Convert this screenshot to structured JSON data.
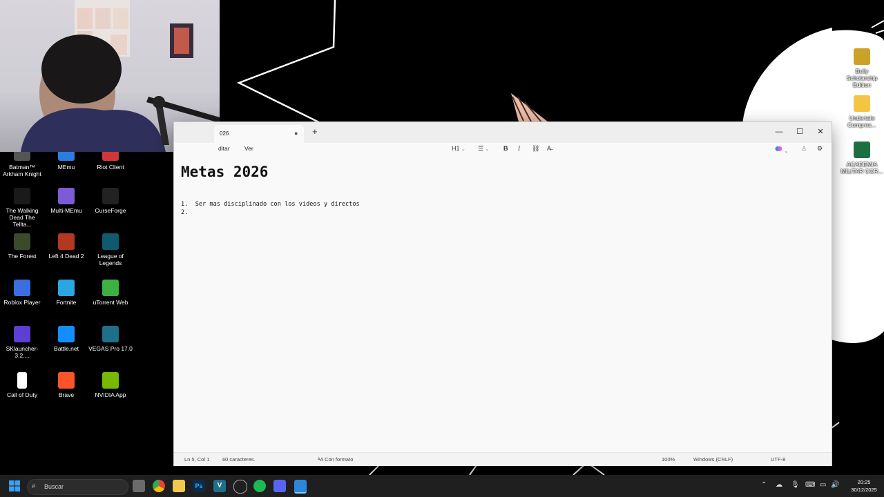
{
  "desktop": {
    "icons_left": [
      {
        "label": "Batman™ Arkham Knight",
        "icon": "batman-icon",
        "color": "#555555"
      },
      {
        "label": "MEmu",
        "icon": "memu-icon",
        "color": "#2a7de1"
      },
      {
        "label": "Riot Client",
        "icon": "riot-icon",
        "color": "#d13639"
      },
      {
        "label": "The Walking Dead The Tellta...",
        "icon": "walking-dead-icon",
        "color": "#1a1a1a"
      },
      {
        "label": "Multi-MEmu",
        "icon": "multi-memu-icon",
        "color": "#7b5cd6"
      },
      {
        "label": "CurseForge",
        "icon": "curseforge-icon",
        "color": "#222222"
      },
      {
        "label": "The Forest",
        "icon": "the-forest-icon",
        "color": "#3b4a2a"
      },
      {
        "label": "Left 4 Dead 2",
        "icon": "left4dead-icon",
        "color": "#b4381f"
      },
      {
        "label": "League of Legends",
        "icon": "league-icon",
        "color": "#0f5a6e"
      },
      {
        "label": "Roblox Player",
        "icon": "roblox-icon",
        "color": "#3b6fe0"
      },
      {
        "label": "Fortnite",
        "icon": "fortnite-icon",
        "color": "#2aa6e0"
      },
      {
        "label": "uTorrent Web",
        "icon": "utorrent-icon",
        "color": "#3cb043"
      },
      {
        "label": "SKlauncher-3.2....",
        "icon": "sklauncher-icon",
        "color": "#5d3fd3"
      },
      {
        "label": "Battle.net",
        "icon": "battlenet-icon",
        "color": "#148eff"
      },
      {
        "label": "VEGAS Pro 17.0",
        "icon": "vegas-icon",
        "color": "#1f6f8b"
      },
      {
        "label": "Call of Duty",
        "icon": "file-icon",
        "color": "#ffffff"
      },
      {
        "label": "Brave",
        "icon": "brave-icon",
        "color": "#fb542b"
      },
      {
        "label": "NVIDIA App",
        "icon": "nvidia-icon",
        "color": "#76b900"
      }
    ],
    "icons_right": [
      {
        "label": "Bully Scholarship Edition",
        "icon": "bully-icon",
        "color": "#c9a227"
      },
      {
        "label": "Undertale Compres...",
        "icon": "folder-icon",
        "color": "#f4c542"
      },
      {
        "label": "ACADEMIA MILITAR COR...",
        "icon": "excel-icon",
        "color": "#1d6f42"
      }
    ]
  },
  "notepad": {
    "tab_title": "026",
    "new_tab_symbol": "+",
    "window_controls": {
      "minimize": "—",
      "maximize": "☐",
      "close": "✕"
    },
    "menus": [
      "ditar",
      "Ver"
    ],
    "toolbar": {
      "heading": "H1",
      "list": "☰",
      "bold": "B",
      "italic": "I",
      "link": "⛓",
      "clear_format": "A̶"
    },
    "doc_title": "Metas 2026",
    "lines": [
      "1.  Ser mas disciplinado con los videos y directos",
      "2."
    ],
    "status": {
      "position": "Ln 5, Col 1",
      "chars": "60 caracteres.",
      "format": "Con formato",
      "zoom": "100%",
      "line_ending": "Windows (CRLF)",
      "encoding": "UTF-8"
    }
  },
  "taskbar": {
    "search_placeholder": "Buscar",
    "time": "20:25",
    "date": "30/12/2025"
  }
}
